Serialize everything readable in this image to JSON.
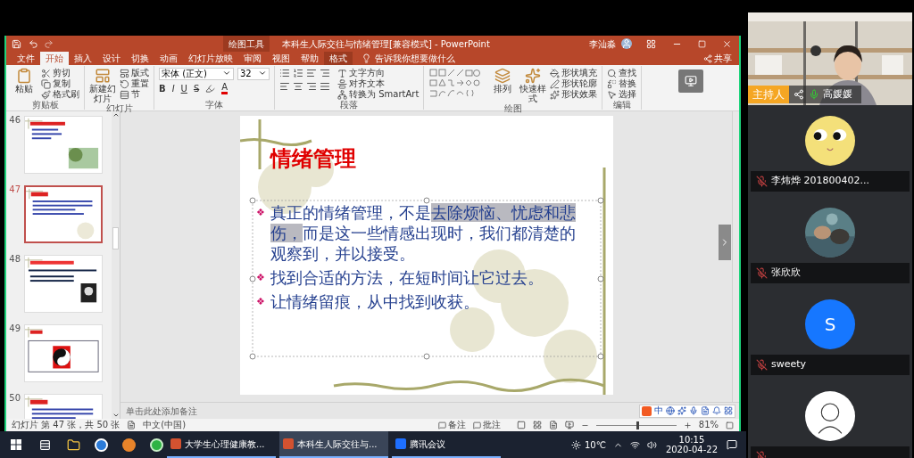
{
  "title_bar": {
    "context_label": "绘图工具",
    "title": "本科生人际交往与情绪管理[兼容模式] - PowerPoint",
    "user": "李汕淼"
  },
  "tabs": [
    {
      "label": "文件",
      "selected": false,
      "contextual": false
    },
    {
      "label": "开始",
      "selected": true,
      "contextual": false
    },
    {
      "label": "插入",
      "selected": false,
      "contextual": false
    },
    {
      "label": "设计",
      "selected": false,
      "contextual": false
    },
    {
      "label": "切换",
      "selected": false,
      "contextual": false
    },
    {
      "label": "动画",
      "selected": false,
      "contextual": false
    },
    {
      "label": "幻灯片放映",
      "selected": false,
      "contextual": false
    },
    {
      "label": "审阅",
      "selected": false,
      "contextual": false
    },
    {
      "label": "视图",
      "selected": false,
      "contextual": false
    },
    {
      "label": "帮助",
      "selected": false,
      "contextual": false
    },
    {
      "label": "格式",
      "selected": false,
      "contextual": true
    }
  ],
  "tell_me": "告诉我你想要做什么",
  "share": "共享",
  "ribbon": [
    {
      "kind": "buttons",
      "label": "剪贴板",
      "large": [
        "粘贴"
      ],
      "small": [
        "剪切",
        "复制",
        "格式刷"
      ]
    },
    {
      "kind": "buttons",
      "label": "幻灯片",
      "large": [
        "新建幻灯片"
      ],
      "small": [
        "版式",
        "重置",
        "节"
      ]
    },
    {
      "kind": "font",
      "label": "字体",
      "font_name": "宋体 (正文)",
      "font_size": "32",
      "format_buttons": [
        "B",
        "I",
        "U",
        "S"
      ],
      "color_buttons": [
        {
          "label": "A",
          "color": "#e00000"
        }
      ]
    },
    {
      "kind": "paragraph",
      "label": "段落",
      "small": [
        "文字方向",
        "对齐文本",
        "转换为 SmartArt"
      ]
    },
    {
      "kind": "shapes",
      "label": "绘图",
      "large": [
        "排列",
        "快速样式"
      ],
      "small": [
        "形状填充",
        "形状轮廓",
        "形状效果"
      ]
    },
    {
      "kind": "buttons",
      "label": "编辑",
      "small": [
        "查找",
        "替换",
        "选择"
      ]
    }
  ],
  "thumbnails": [
    {
      "number": "46",
      "selected": false,
      "kind": "picture_right"
    },
    {
      "number": "47",
      "selected": true,
      "kind": "text"
    },
    {
      "number": "48",
      "selected": false,
      "kind": "portrait"
    },
    {
      "number": "49",
      "selected": false,
      "kind": "diagram"
    },
    {
      "number": "50",
      "selected": false,
      "kind": "text"
    }
  ],
  "slide": {
    "title": "情绪管理",
    "bullets": [
      {
        "mark": "❖",
        "parts": [
          {
            "text": "真正的情绪管理，不是",
            "selected": false
          },
          {
            "text": "去除烦恼、忧虑和悲伤，",
            "selected": true
          },
          {
            "text": "而是这一些情感出现时，我们都清楚的观察到，并以接受。",
            "selected": false
          }
        ]
      },
      {
        "mark": "❖",
        "parts": [
          {
            "text": "找到合适的方法，在短时间让它过去。",
            "selected": false
          }
        ]
      },
      {
        "mark": "❖",
        "parts": [
          {
            "text": "让情绪留痕，从中找到收获。",
            "selected": false
          }
        ]
      }
    ]
  },
  "notes_placeholder": "单击此处添加备注",
  "ime_bar": {
    "label": "中"
  },
  "status_bar": {
    "slide_info": "幻灯片 第 47 张，共 50 张",
    "language": "中文(中国)",
    "notes": "备注",
    "comments": "批注",
    "zoom": "81%",
    "zoom_level": {
      "level": 0.5
    }
  },
  "meeting": {
    "host": {
      "badge": "主持人",
      "name": "高媛媛",
      "muted": false
    },
    "participants": [
      {
        "name": "李炜烨 201800402...",
        "muted": true,
        "kind": "cartoon"
      },
      {
        "name": "张欣欣",
        "muted": true
      },
      {
        "name": "sweety",
        "muted": true,
        "kind": "letter",
        "letter": "S",
        "color": "#1677ff"
      },
      {
        "muted": true,
        "kind": "person"
      }
    ]
  },
  "taskbar": {
    "apps": [
      {
        "label": "大学生心理健康教...",
        "selected": false,
        "kind": "ppt"
      },
      {
        "label": "本科生人际交往与...",
        "selected": true,
        "kind": "ppt"
      },
      {
        "label": "腾讯会议",
        "selected": false,
        "kind": "meeting"
      }
    ],
    "weather": "10℃",
    "time": "10:15",
    "date": "2020-04-22"
  }
}
